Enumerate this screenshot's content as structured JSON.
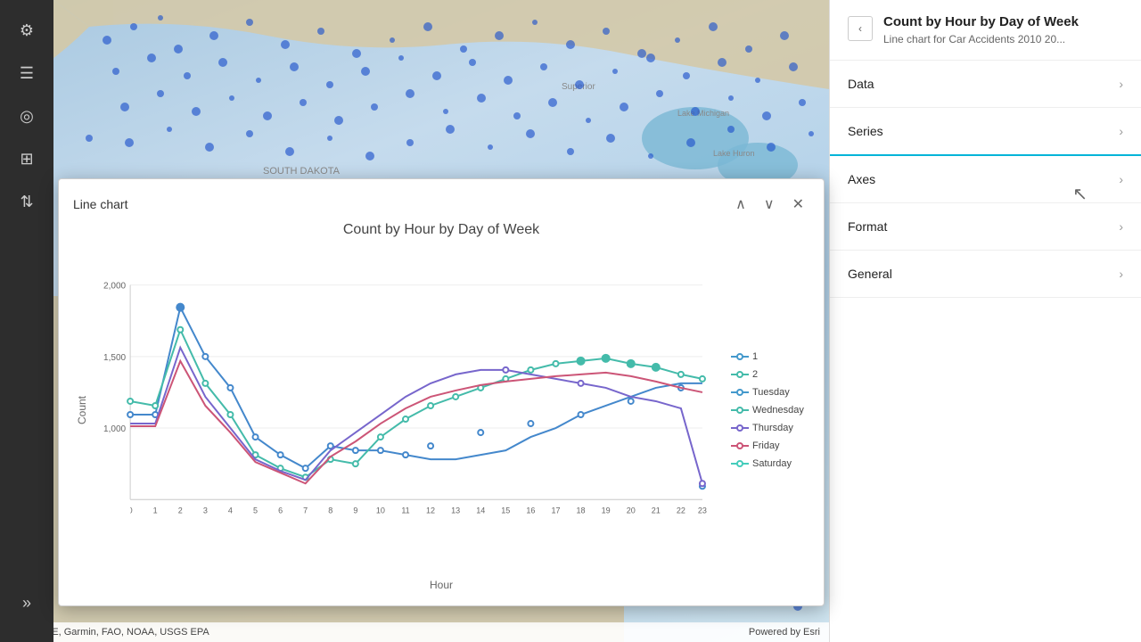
{
  "app": {
    "title": "Count by Hour by Day of Week",
    "subtitle": "Line chart for Car Accidents 2010 20..."
  },
  "sidebar": {
    "icons": [
      {
        "name": "settings-icon",
        "symbol": "⚙",
        "interactable": true
      },
      {
        "name": "list-icon",
        "symbol": "≡",
        "interactable": true
      },
      {
        "name": "search-icon",
        "symbol": "⊙",
        "interactable": true
      },
      {
        "name": "table-icon",
        "symbol": "⊞",
        "interactable": true
      },
      {
        "name": "sort-icon",
        "symbol": "⇅",
        "interactable": true
      },
      {
        "name": "expand-icon",
        "symbol": "»",
        "interactable": true
      }
    ]
  },
  "chart": {
    "title": "Count by Hour by Day of Week",
    "panel_title": "Line chart",
    "x_label": "Hour",
    "y_label": "Count",
    "y_ticks": [
      "2,000",
      "1,500",
      "1,000"
    ],
    "x_ticks": [
      "0",
      "1",
      "2",
      "3",
      "4",
      "5",
      "6",
      "7",
      "8",
      "9",
      "10",
      "11",
      "12",
      "13",
      "14",
      "15",
      "16",
      "17",
      "18",
      "19",
      "20",
      "21",
      "22",
      "23"
    ],
    "legend": [
      {
        "label": "1",
        "color": "#4499cc"
      },
      {
        "label": "2",
        "color": "#44bbaa"
      },
      {
        "label": "Tuesday",
        "color": "#4499cc"
      },
      {
        "label": "Wednesday",
        "color": "#44bbaa"
      },
      {
        "label": "Thursday",
        "color": "#7766cc"
      },
      {
        "label": "Friday",
        "color": "#cc4477"
      },
      {
        "label": "Saturday",
        "color": "#44ccbb"
      }
    ]
  },
  "right_panel": {
    "title": "Count by Hour by Day of Week",
    "subtitle": "Line chart for Car Accidents 2010 20...",
    "menu_items": [
      {
        "label": "Data",
        "id": "data"
      },
      {
        "label": "Series",
        "id": "series",
        "active": true
      },
      {
        "label": "Axes",
        "id": "axes"
      },
      {
        "label": "Format",
        "id": "format"
      },
      {
        "label": "General",
        "id": "general"
      }
    ],
    "collapse_label": "‹"
  },
  "bottom_bar": {
    "left": "Esri, HERE, Garmin, FAO, NOAA, USGS  EPA",
    "right": "Powered by Esri"
  }
}
